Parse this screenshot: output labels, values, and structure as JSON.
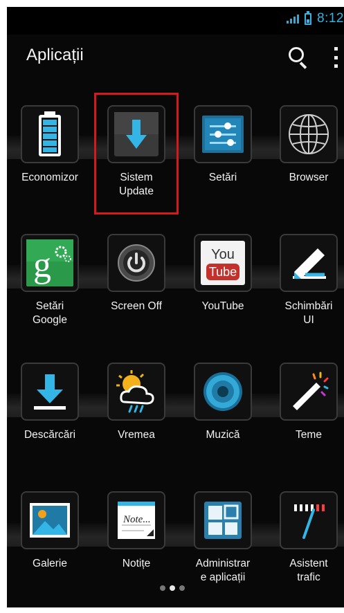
{
  "status_bar": {
    "time": "8:12"
  },
  "action_bar": {
    "title": "Aplicații",
    "search_icon": "search-icon",
    "overflow_icon": "overflow-menu-icon"
  },
  "apps": [
    {
      "label": "Economizor",
      "icon": "battery-saver-icon"
    },
    {
      "label": "Sistem\nUpdate",
      "icon": "system-update-icon",
      "highlighted": true
    },
    {
      "label": "Setări",
      "icon": "settings-icon"
    },
    {
      "label": "Browser",
      "icon": "globe-icon"
    },
    {
      "label": "Setări\nGoogle",
      "icon": "google-settings-icon"
    },
    {
      "label": "Screen Off",
      "icon": "power-icon"
    },
    {
      "label": "YouTube",
      "icon": "youtube-icon"
    },
    {
      "label": "Schimbări\nUI",
      "icon": "pen-icon"
    },
    {
      "label": "Descărcări",
      "icon": "download-icon"
    },
    {
      "label": "Vremea",
      "icon": "weather-icon"
    },
    {
      "label": "Muzică",
      "icon": "speaker-icon"
    },
    {
      "label": "Teme",
      "icon": "magic-wand-icon"
    },
    {
      "label": "Galerie",
      "icon": "gallery-icon"
    },
    {
      "label": "Notițe",
      "icon": "notes-icon"
    },
    {
      "label": "Administrar\ne aplicații",
      "icon": "app-manager-icon"
    },
    {
      "label": "Asistent\ntrafic",
      "icon": "traffic-gauge-icon"
    }
  ],
  "icon_text": {
    "youtube_top": "You",
    "youtube_bottom": "Tube",
    "notes": "Note..."
  },
  "colors": {
    "accent_blue": "#33b5e5",
    "highlight_red": "#d41a1a",
    "google_green": "#2a9a4a",
    "youtube_red": "#c4302b"
  },
  "pagination": {
    "pages": 3,
    "active": 1
  }
}
